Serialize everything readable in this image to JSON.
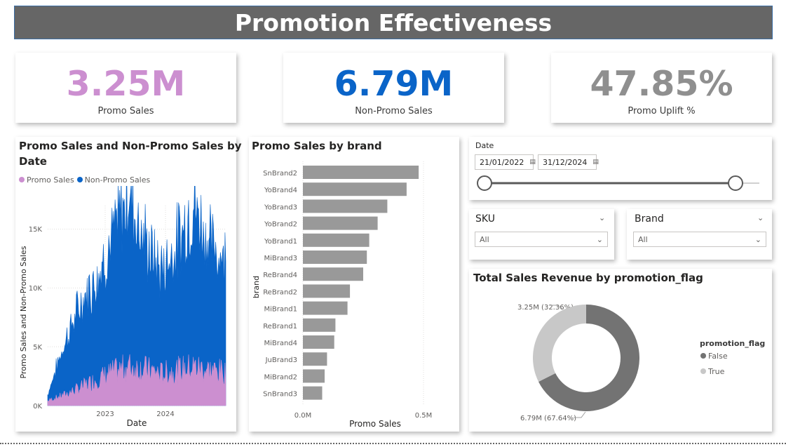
{
  "title": "Promotion Effectiveness",
  "kpis": [
    {
      "value": "3.25M",
      "label": "Promo Sales",
      "color": "#cc8fd0"
    },
    {
      "value": "6.79M",
      "label": "Non-Promo Sales",
      "color": "#0a64c8"
    },
    {
      "value": "47.85%",
      "label": "Promo Uplift %",
      "color": "#8f8f8f"
    }
  ],
  "date_chart": {
    "title_line1": "Promo Sales and Non-Promo Sales by",
    "title_line2": "Date",
    "legend": [
      "Promo Sales",
      "Non-Promo Sales"
    ],
    "ylabel": "Promo Sales and Non-Promo Sales",
    "xlabel": "Date",
    "yticks": [
      "0K",
      "5K",
      "10K",
      "15K"
    ],
    "xticks": [
      "2023",
      "2024"
    ]
  },
  "brand_chart": {
    "title": "Promo Sales by brand",
    "ylabel": "brand",
    "xlabel": "Promo Sales",
    "xticks": [
      "0.0M",
      "0.5M"
    ]
  },
  "date_slicer": {
    "label": "Date",
    "start": "21/01/2022",
    "end": "31/12/2024"
  },
  "sku_slicer": {
    "label": "SKU",
    "value": "All"
  },
  "brand_slicer": {
    "label": "Brand",
    "value": "All"
  },
  "donut": {
    "title": "Total Sales Revenue by promotion_flag",
    "legend_title": "promotion_flag",
    "legend": [
      "False",
      "True"
    ],
    "label_true": "3.25M (32.36%)",
    "label_false": "6.79M (67.64%)"
  },
  "colors": {
    "promo": "#cc8fd0",
    "non_promo": "#0a64c8",
    "bar": "#999999",
    "donut_false": "#737373",
    "donut_true": "#c8c8c8"
  },
  "chart_data": [
    {
      "type": "area",
      "title": "Promo Sales and Non-Promo Sales by Date",
      "xlabel": "Date",
      "ylabel": "Promo Sales and Non-Promo Sales",
      "ylim": [
        0,
        17000
      ],
      "x": [
        "2022-03",
        "2022-06",
        "2022-09",
        "2022-12",
        "2023-03",
        "2023-06",
        "2023-09",
        "2023-12",
        "2024-03",
        "2024-06",
        "2024-09",
        "2024-12"
      ],
      "series": [
        {
          "name": "Promo Sales",
          "values": [
            400,
            900,
            1500,
            2200,
            2800,
            3300,
            3100,
            2700,
            3000,
            3300,
            3000,
            2800
          ]
        },
        {
          "name": "Non-Promo Sales",
          "values": [
            500,
            4200,
            6800,
            8500,
            11000,
            14500,
            10500,
            8500,
            10500,
            13500,
            10500,
            9500
          ]
        }
      ],
      "legend": "top-left",
      "grid": true
    },
    {
      "type": "bar",
      "title": "Promo Sales by brand",
      "orientation": "horizontal",
      "categories": [
        "SnBrand2",
        "YoBrand4",
        "YoBrand3",
        "YoBrand2",
        "YoBrand1",
        "MiBrand3",
        "ReBrand4",
        "ReBrand2",
        "MiBrand1",
        "ReBrand1",
        "MiBrand4",
        "JuBrand3",
        "MiBrand2",
        "SnBrand3"
      ],
      "values": [
        0.48,
        0.43,
        0.35,
        0.31,
        0.275,
        0.265,
        0.25,
        0.195,
        0.185,
        0.135,
        0.13,
        0.1,
        0.09,
        0.08
      ],
      "xlabel": "Promo Sales",
      "ylabel": "brand",
      "xlim": [
        0,
        0.55
      ],
      "unit": "M"
    },
    {
      "type": "pie",
      "title": "Total Sales Revenue by promotion_flag",
      "categories": [
        "False",
        "True"
      ],
      "values": [
        6.79,
        3.25
      ],
      "percent": [
        67.64,
        32.36
      ],
      "donut": true
    }
  ]
}
